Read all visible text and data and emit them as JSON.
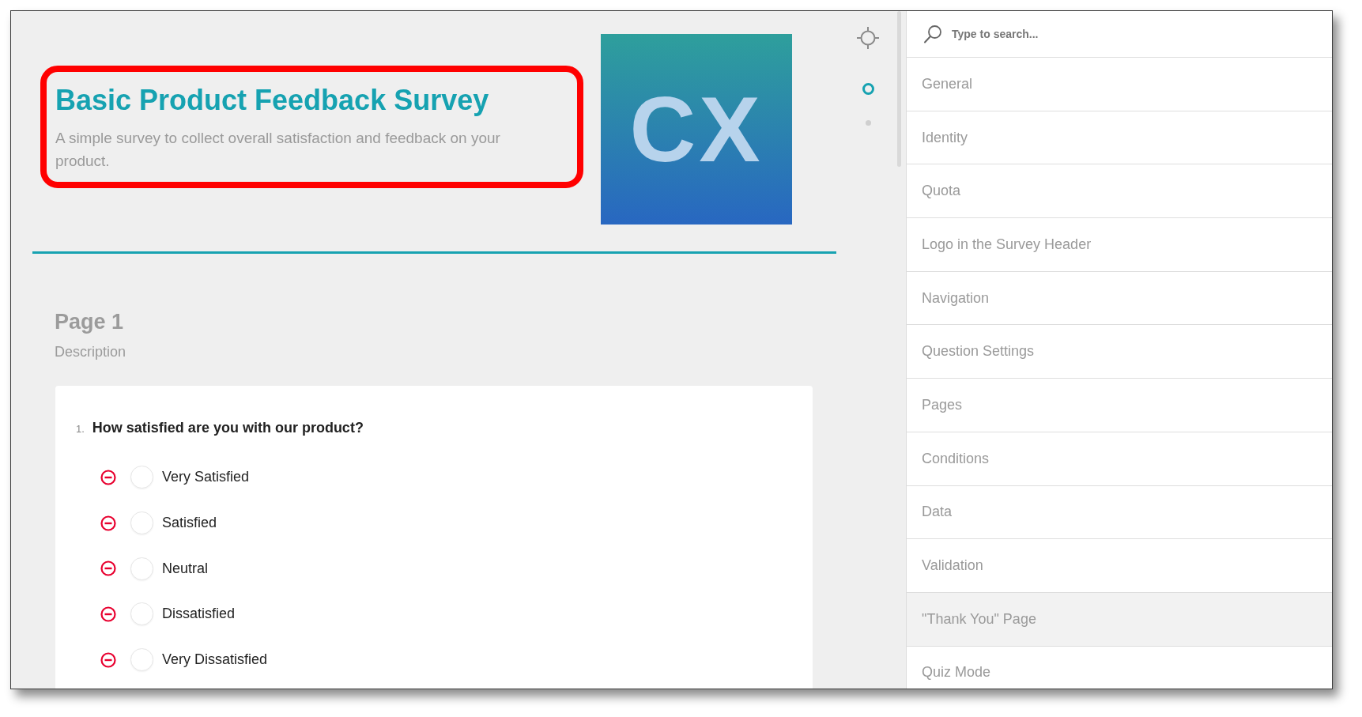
{
  "header": {
    "title": "Basic Product Feedback Survey",
    "description": "A simple survey to collect overall satisfaction and feedback on your product.",
    "highlighted": true
  },
  "logo": {
    "text": "CX"
  },
  "page_markers": [
    {
      "selected": true
    },
    {
      "selected": false
    }
  ],
  "page": {
    "title": "Page 1",
    "description": "Description"
  },
  "questions": [
    {
      "number": "1.",
      "text": "How satisfied are you with our product?",
      "choices": [
        {
          "label": "Very Satisfied",
          "selected": false
        },
        {
          "label": "Satisfied",
          "selected": false
        },
        {
          "label": "Neutral",
          "selected": false
        },
        {
          "label": "Dissatisfied",
          "selected": false
        },
        {
          "label": "Very Dissatisfied",
          "selected": false
        }
      ]
    }
  ],
  "sidebar": {
    "search": {
      "placeholder": "Type to search..."
    },
    "items": [
      {
        "label": "General",
        "selected": false
      },
      {
        "label": "Identity",
        "selected": false
      },
      {
        "label": "Quota",
        "selected": false
      },
      {
        "label": "Logo in the Survey Header",
        "selected": false
      },
      {
        "label": "Navigation",
        "selected": false
      },
      {
        "label": "Question Settings",
        "selected": false
      },
      {
        "label": "Pages",
        "selected": false
      },
      {
        "label": "Conditions",
        "selected": false
      },
      {
        "label": "Data",
        "selected": false
      },
      {
        "label": "Validation",
        "selected": false
      },
      {
        "label": "\"Thank You\" Page",
        "selected": true
      },
      {
        "label": "Quiz Mode",
        "selected": false
      }
    ]
  }
}
